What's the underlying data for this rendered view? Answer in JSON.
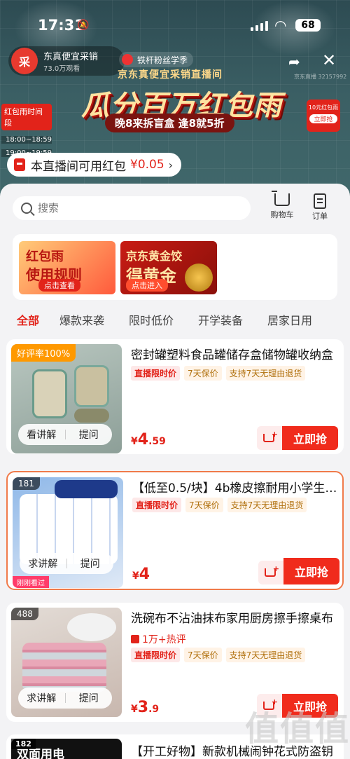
{
  "status": {
    "time": "17:31",
    "battery": "68"
  },
  "live": {
    "anchor_name": "东真便宜采销",
    "anchor_avatar_text": "采",
    "views": "73.0万观看",
    "fans_tag": "铁杆粉丝学季",
    "banner_title_top": "京东真便宜采销直播间",
    "banner_main": "瓜分百万红包雨",
    "banner_sub": "晚8来拆盲盒 逢8就5折",
    "room_id": "京东直播 32157992",
    "rain_time_title": "红包雨时间段",
    "rain_times": [
      "18:00~18:59",
      "19:00~19:59"
    ],
    "float_redpack_label": "10元红包雨",
    "float_redpack_btn": "立即抢"
  },
  "available_redpack": {
    "label": "本直播间可用红包",
    "amount": "¥0.05"
  },
  "search": {
    "placeholder": "搜索"
  },
  "top_actions": {
    "cart": "购物车",
    "orders": "订单"
  },
  "promos": {
    "rules": {
      "line1": "红包雨",
      "line2": "使用规则",
      "btn": "点击查看"
    },
    "gold": {
      "line1": "京东黄金饺",
      "line2": "得黄金",
      "btn": "点击进入"
    }
  },
  "tabs": [
    "全部",
    "爆款来袭",
    "限时低价",
    "开学装备",
    "居家日用"
  ],
  "products": [
    {
      "badge": "好评率100%",
      "title": "密封罐塑料食品罐储存盒储物罐收纳盒",
      "tags": [
        "直播限时价",
        "7天保价",
        "支持7天无理由退货"
      ],
      "price_int": "4",
      "price_dec": ".59",
      "explain": "看讲解",
      "ask": "提问",
      "buy": "立即抢"
    },
    {
      "badge": "181",
      "title": "【低至0.5/块】4b橡皮擦耐用小学生专用",
      "tags": [
        "直播限时价",
        "7天保价",
        "支持7天无理由退货"
      ],
      "price_int": "4",
      "price_dec": "",
      "explain": "求讲解",
      "ask": "提问",
      "watched": "刚刚看过",
      "buy": "立即抢"
    },
    {
      "badge": "488",
      "title": "洗碗布不沾油抹布家用厨房擦手擦桌布",
      "hot": "1万+热评",
      "tags": [
        "直播限时价",
        "7天保价",
        "支持7天无理由退货"
      ],
      "price_int": "3",
      "price_dec": ".9",
      "explain": "求讲解",
      "ask": "提问",
      "buy": "立即抢"
    }
  ],
  "partial": {
    "badge": "182",
    "thumb_text": "双面用电",
    "title": "【开工好物】新款机械闹钟花式防盗钥"
  },
  "currency": "¥",
  "watermark": "值值值"
}
